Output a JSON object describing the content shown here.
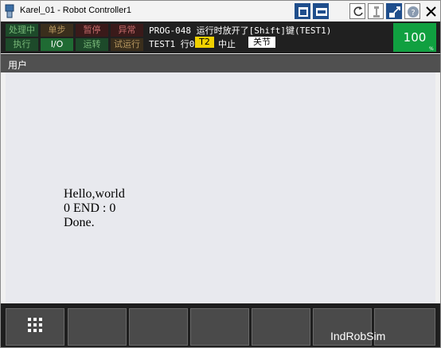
{
  "window": {
    "title": "Karel_01 - Robot Controller1"
  },
  "status": {
    "leds_row1": [
      "处理中",
      "单步",
      "暂停",
      "异常"
    ],
    "leds_row2": [
      "执行",
      "I/O",
      "运转",
      "试运行"
    ],
    "message_line1": "PROG-048 运行时放开了[Shift]键(TEST1)",
    "program_line": "TEST1 行0",
    "mode_badge": "T2",
    "state": "中止",
    "coord_badge": "关节",
    "override": "100",
    "override_unit": "%"
  },
  "menu": {
    "label": "用户"
  },
  "user_screen": {
    "lines": [
      "Hello,world",
      "0 END : 0",
      "Done."
    ]
  },
  "watermark": "IndRobSim",
  "colors": {
    "override_bg": "#10a040",
    "mode_badge_bg": "#f0d000",
    "io_led_bg": "#1f6b33"
  },
  "icons": [
    "teach-pendant-icon",
    "layout-single-icon",
    "layout-dual-icon",
    "reset-icon",
    "robot-icon",
    "jog-icon",
    "help-icon",
    "close-icon",
    "grid-menu-icon"
  ]
}
